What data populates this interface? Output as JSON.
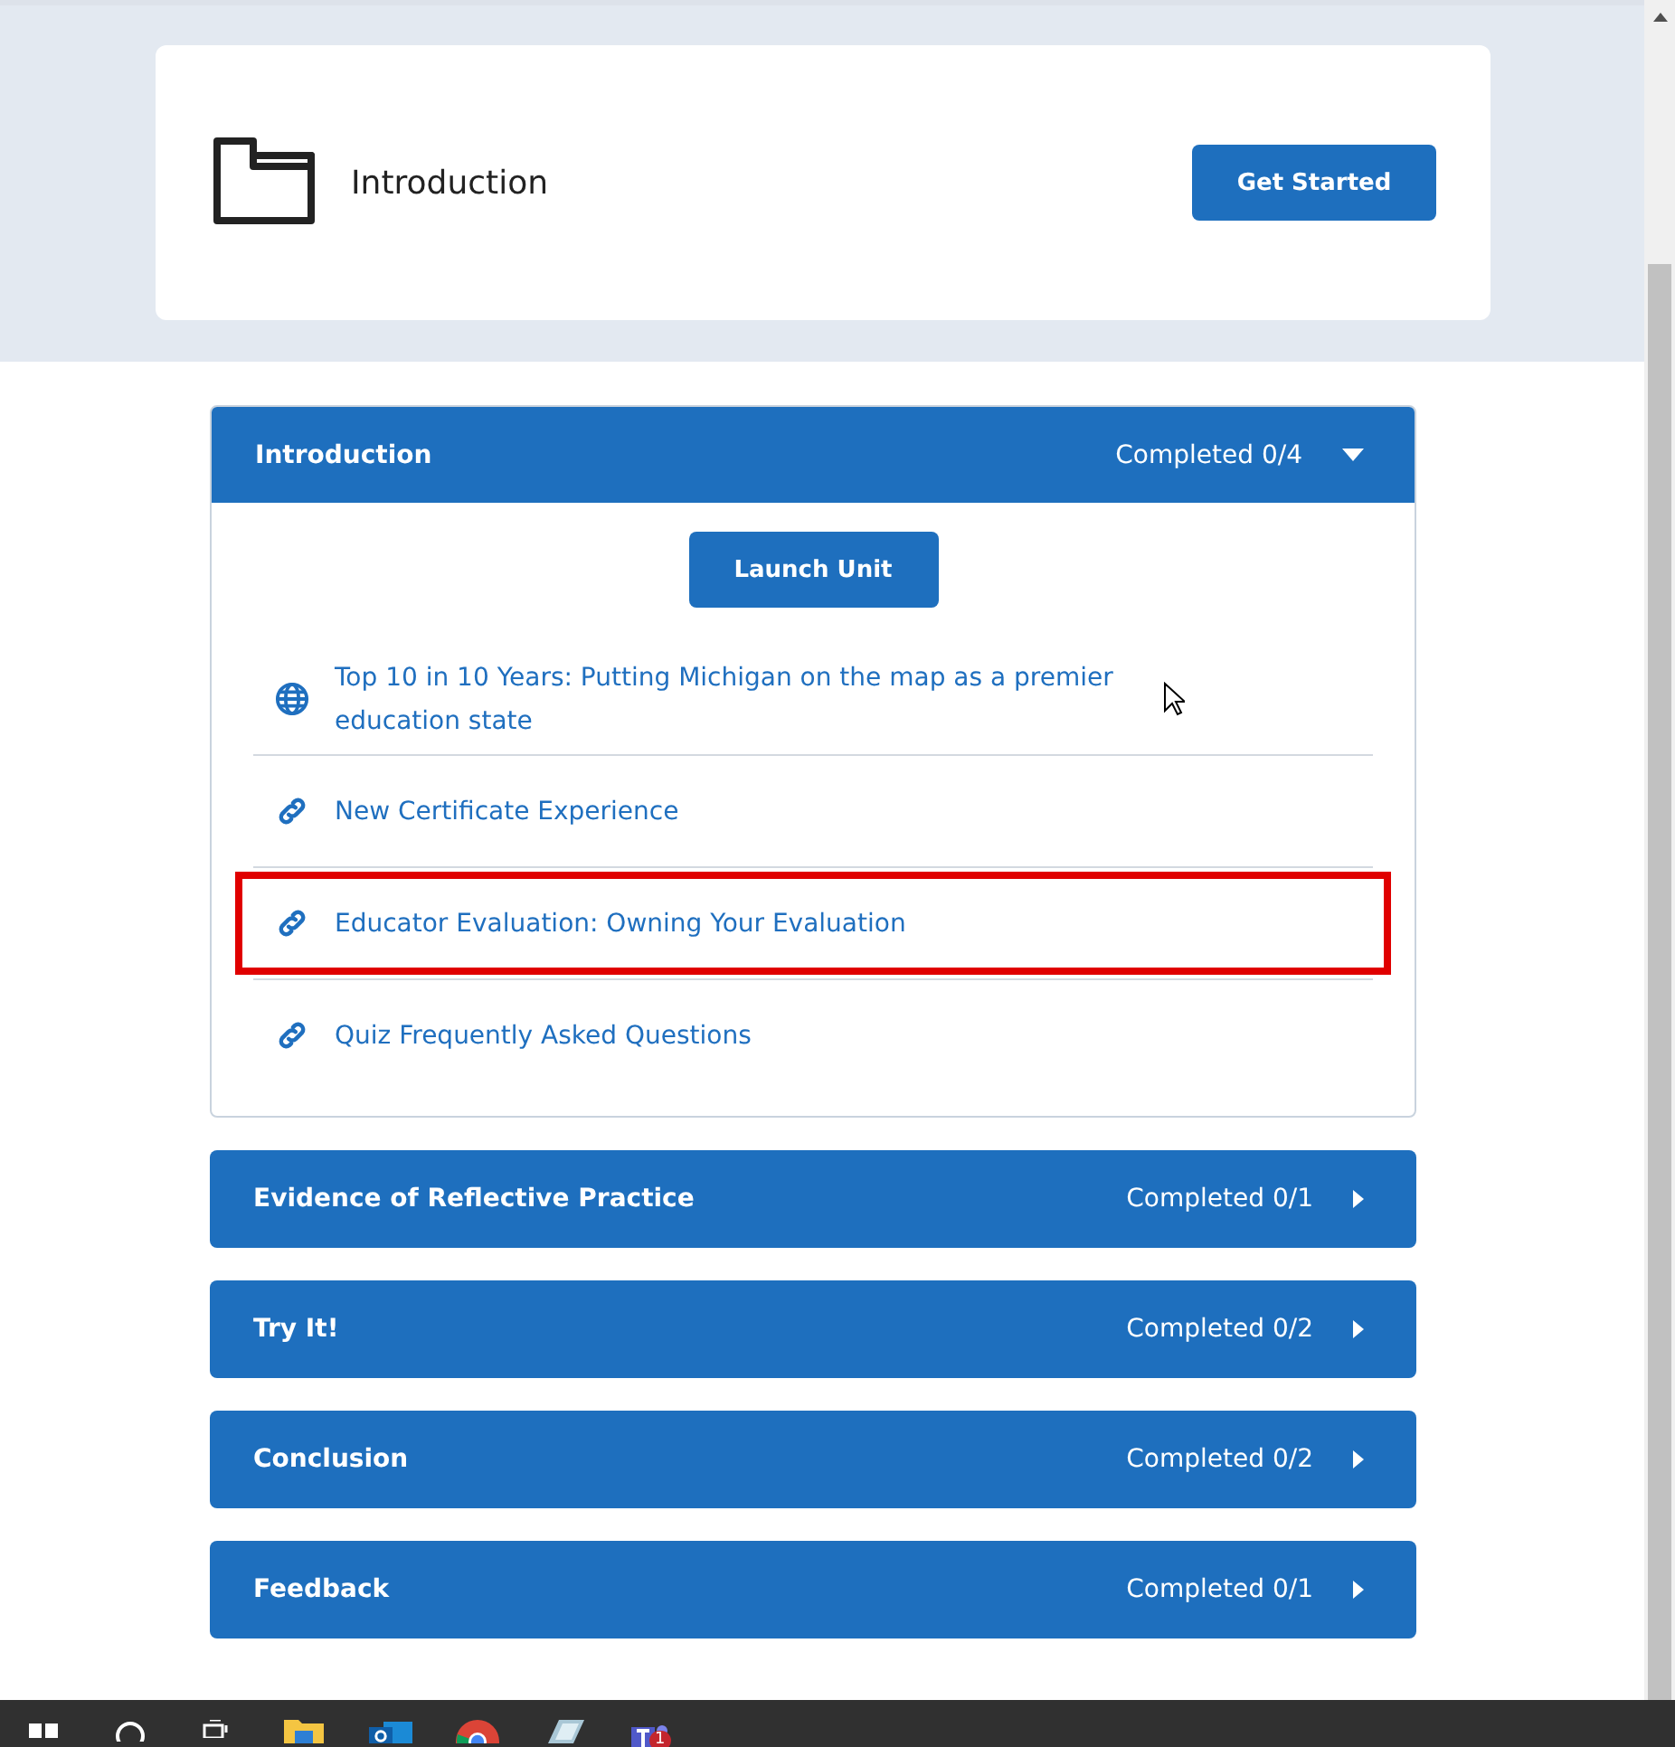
{
  "hero": {
    "title": "Introduction",
    "button": "Get Started"
  },
  "sections": [
    {
      "title": "Introduction",
      "status": "Completed 0/4",
      "expanded": true,
      "launch_button": "Launch Unit",
      "items": [
        {
          "kind": "web",
          "text": "Top 10 in 10 Years: Putting Michigan on the map as a premier education state",
          "highlighted": false
        },
        {
          "kind": "link",
          "text": "New Certificate Experience",
          "highlighted": false
        },
        {
          "kind": "link",
          "text": "Educator Evaluation: Owning Your Evaluation",
          "highlighted": true
        },
        {
          "kind": "link",
          "text": "Quiz Frequently Asked Questions",
          "highlighted": false
        }
      ]
    },
    {
      "title": "Evidence of Reflective Practice",
      "status": "Completed 0/1",
      "expanded": false
    },
    {
      "title": "Try It!",
      "status": "Completed 0/2",
      "expanded": false
    },
    {
      "title": "Conclusion",
      "status": "Completed 0/2",
      "expanded": false
    },
    {
      "title": "Feedback",
      "status": "Completed 0/1",
      "expanded": false
    }
  ],
  "taskbar": {
    "apps": [
      {
        "kind": "start"
      },
      {
        "kind": "search"
      },
      {
        "kind": "taskview"
      },
      {
        "kind": "folder"
      },
      {
        "kind": "mail"
      },
      {
        "kind": "browser"
      },
      {
        "kind": "notes"
      },
      {
        "kind": "chat",
        "badge": "1"
      }
    ]
  }
}
